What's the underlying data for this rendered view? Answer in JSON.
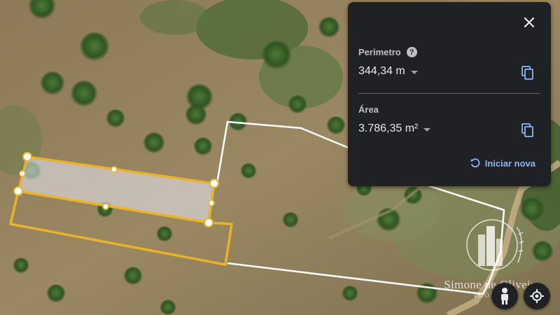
{
  "panel": {
    "perimeter_label": "Perimetro",
    "perimeter_value": "344,34 m",
    "area_label": "Área",
    "area_value": "3.786,35 m²",
    "reset_label": "Iniciar nova"
  },
  "watermark": {
    "name": "Simone de Oliveira",
    "subtitle": "IMÓVEIS"
  },
  "icons": {
    "close": "close-icon",
    "help": "help-icon",
    "copy": "copy-icon",
    "reset": "reset-icon",
    "pegman": "pegman-icon",
    "location": "my-location-icon"
  },
  "colors": {
    "measure_line": "#ffffff",
    "selection_line": "#e8b32a",
    "panel_bg": "#202124",
    "accent": "#8ab4f8"
  }
}
